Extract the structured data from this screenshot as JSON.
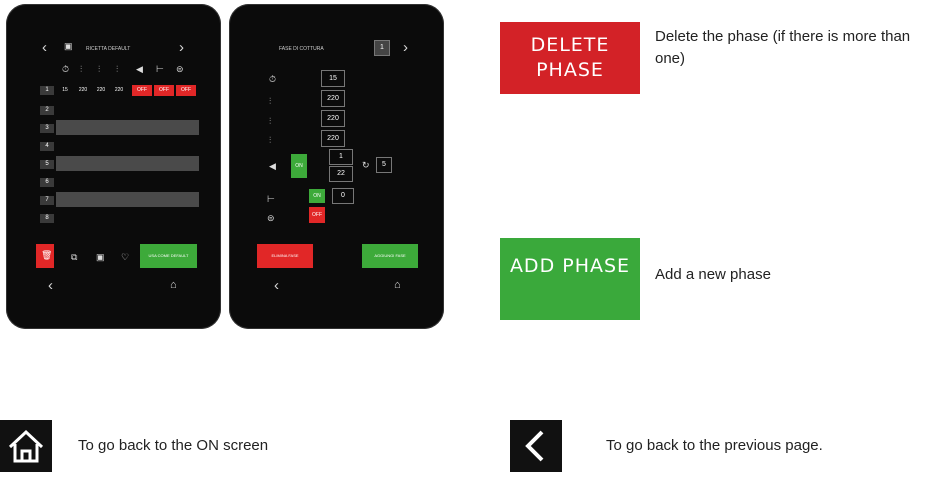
{
  "device1": {
    "title": "RICETTA DEFAULT",
    "row1_values": [
      "15",
      "220",
      "220",
      "220"
    ],
    "row1_off": [
      "OFF",
      "OFF",
      "OFF"
    ],
    "row_numbers": [
      "1",
      "2",
      "3",
      "4",
      "5",
      "6",
      "7",
      "8"
    ],
    "use_default_label": "USA COME DEFAULT"
  },
  "device2": {
    "title": "FASE DI COTTURA",
    "phase_number": "1",
    "time_value": "15",
    "temp1": "220",
    "temp2": "220",
    "temp3": "220",
    "fan_on": "ON",
    "fan_val1": "1",
    "fan_val2": "22",
    "cycle_value": "5",
    "steam_on": "ON",
    "steam_value": "0",
    "vent_off": "OFF",
    "delete_label": "ELIMINA FASE",
    "add_label": "AGGIUNGI FASE"
  },
  "legend": {
    "delete_button": "DELETE PHASE",
    "delete_desc": "Delete the phase (if there is more than one)",
    "add_button": "ADD PHASE",
    "add_desc": "Add a new phase",
    "home_desc": "To go back to the ON screen",
    "back_desc": "To go back to the previous page."
  },
  "colors": {
    "red": "#e12727",
    "green": "#3daa3a",
    "dark": "#0b0b0b"
  }
}
